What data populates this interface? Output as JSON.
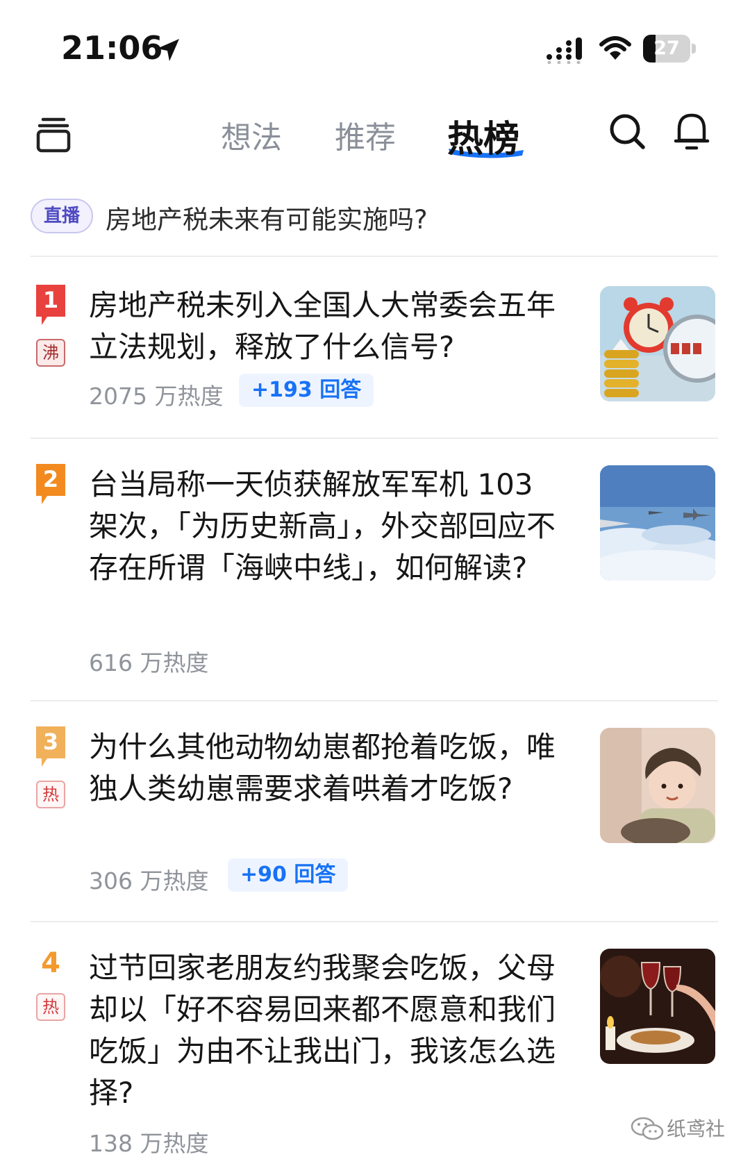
{
  "status_bar": {
    "time": "21:06",
    "battery_level": "27",
    "battery_fraction": 0.27
  },
  "nav": {
    "tabs": [
      "想法",
      "推荐",
      "热榜"
    ],
    "active_tab": "热榜",
    "accent_color": "#1772f6"
  },
  "live_banner": {
    "badge": "直播",
    "text": "房地产税未来有可能实施吗?"
  },
  "hot_list": [
    {
      "rank": "1",
      "tag": "沸",
      "title": "房地产税未列入全国人大常委会五年立法规划，释放了什么信号?",
      "heat": "2075 万热度",
      "answers": "+193 回答",
      "thumb": "clock-coins-magnifier"
    },
    {
      "rank": "2",
      "tag": "",
      "title": "台当局称一天侦获解放军军机 103 架次，「为历史新高」，外交部回应不存在所谓「海峡中线」，如何解读?",
      "heat": "616 万热度",
      "answers": "",
      "thumb": "jets-over-clouds"
    },
    {
      "rank": "3",
      "tag": "热",
      "title": "为什么其他动物幼崽都抢着吃饭，唯独人类幼崽需要求着哄着才吃饭?",
      "heat": "306 万热度",
      "answers": "+90 回答",
      "thumb": "child-portrait"
    },
    {
      "rank": "4",
      "tag": "热",
      "title": "过节回家老朋友约我聚会吃饭，父母却以「好不容易回来都不愿意和我们吃饭」为由不让我出门，我该怎么选择?",
      "heat": "138 万热度",
      "answers": "",
      "thumb": "dinner-wine"
    }
  ],
  "watermark": {
    "text": "纸鸢社"
  }
}
